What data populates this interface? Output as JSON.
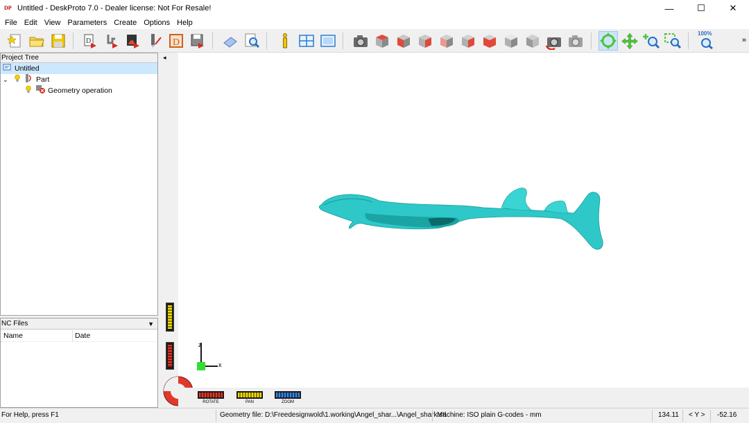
{
  "window": {
    "app_icon_text": "DP",
    "title": "Untitled - DeskProto 7.0 - Dealer license: Not For Resale!",
    "minimize": "—",
    "maximize": "☐",
    "close": "✕"
  },
  "menu": [
    "File",
    "Edit",
    "View",
    "Parameters",
    "Create",
    "Options",
    "Help"
  ],
  "toolbar": {
    "zoom_percent_label": "100%",
    "overflow": "»"
  },
  "project_tree": {
    "header": "Project Tree",
    "root": "Untitled",
    "part": "Part",
    "geometry_operation": "Geometry operation"
  },
  "nc_files": {
    "header": "NC Files",
    "col_name": "Name",
    "col_date": "Date"
  },
  "viewport": {
    "collapse_arrow": "◂",
    "axis_z": "z",
    "axis_x": "x",
    "legend_rotate": "ROTATE",
    "legend_pan": "PAN",
    "legend_zoom": "ZOOM",
    "model_color": "#2ec8c8"
  },
  "status": {
    "help": "For Help, press F1",
    "geometry_file": "Geometry file: D:\\Freedesignwold\\1.working\\Angel_shar...\\Angel_shark.stl",
    "machine": "Machine: ISO plain G-codes - mm",
    "coord_x": "134.11",
    "coord_axis": "< Y >",
    "coord_y": "-52.16"
  }
}
